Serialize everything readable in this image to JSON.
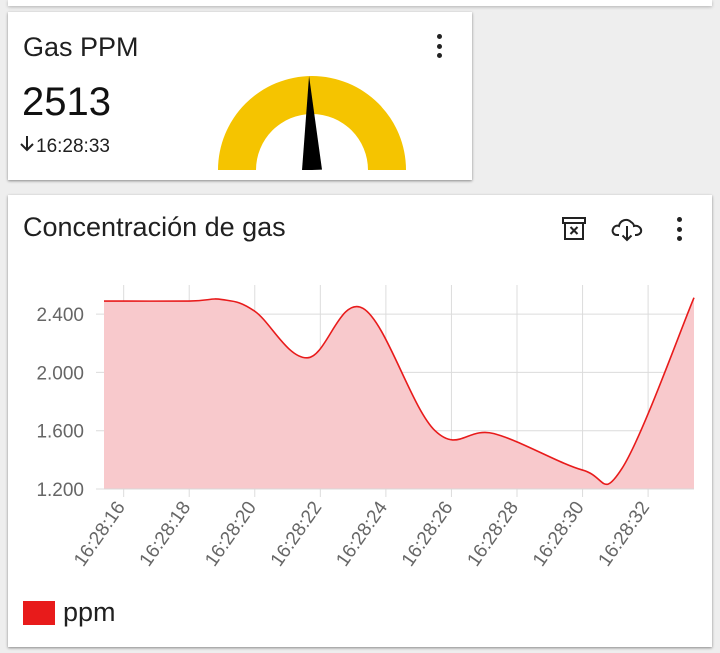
{
  "gauge_card": {
    "title": "Gas PPM",
    "value": "2513",
    "timestamp": "16:28:33",
    "icons": [
      "more-vert-icon",
      "arrow-down-icon"
    ],
    "gauge_fill_fraction": 0.49,
    "colors": {
      "arc": "#f5c400",
      "needle": "#000000"
    }
  },
  "chart_card": {
    "title": "Concentración de gas",
    "icons": [
      "delete-icon",
      "cloud-download-icon",
      "more-vert-icon"
    ]
  },
  "chart_data": {
    "type": "area",
    "title": "Concentración de gas",
    "xlabel": "",
    "ylabel": "",
    "series": [
      {
        "name": "ppm",
        "color": "#e81b1b",
        "fill": "#f8c9cc",
        "points": [
          {
            "t": "16:28:15.4",
            "v": 2490
          },
          {
            "t": "16:28:18.0",
            "v": 2490
          },
          {
            "t": "16:28:19.0",
            "v": 2500
          },
          {
            "t": "16:28:20.0",
            "v": 2420
          },
          {
            "t": "16:28:21.6",
            "v": 2100
          },
          {
            "t": "16:28:23.3",
            "v": 2440
          },
          {
            "t": "16:28:25.5",
            "v": 1600
          },
          {
            "t": "16:28:27.3",
            "v": 1580
          },
          {
            "t": "16:28:30.0",
            "v": 1330
          },
          {
            "t": "16:28:31.2",
            "v": 1340
          },
          {
            "t": "16:28:33.4",
            "v": 2513
          }
        ]
      }
    ],
    "x_ticks": [
      "16:28:16",
      "16:28:18",
      "16:28:20",
      "16:28:22",
      "16:28:24",
      "16:28:26",
      "16:28:28",
      "16:28:30",
      "16:28:32"
    ],
    "y_ticks": [
      "1.200",
      "1.600",
      "2.000",
      "2.400"
    ],
    "y_tick_values": [
      1200,
      1600,
      2000,
      2400
    ],
    "ylim": [
      1200,
      2600
    ],
    "xlim": [
      "16:28:15.4",
      "16:28:33.4"
    ],
    "grid": true,
    "legend_position": "bottom-left",
    "legend": [
      "ppm"
    ]
  }
}
